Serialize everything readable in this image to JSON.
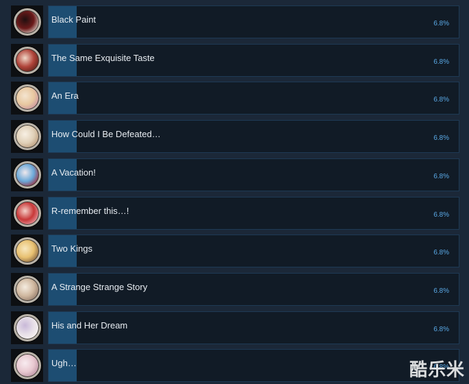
{
  "achievements": [
    {
      "name": "Black Paint",
      "percent": "6.8%",
      "fill_fraction": 0.068,
      "icon": "achievement-icon-black-paint",
      "colors": [
        "#6b1a1a",
        "#201010",
        "#d8d0c8"
      ]
    },
    {
      "name": "The Same Exquisite Taste",
      "percent": "6.8%",
      "fill_fraction": 0.068,
      "icon": "achievement-icon-exquisite-taste",
      "colors": [
        "#b0443a",
        "#f0d8c8",
        "#5a2018"
      ]
    },
    {
      "name": "An Era",
      "percent": "6.8%",
      "fill_fraction": 0.068,
      "icon": "achievement-icon-an-era",
      "colors": [
        "#e8c8a0",
        "#f4e4d0",
        "#c890a0"
      ]
    },
    {
      "name": "How Could I Be Defeated…",
      "percent": "6.8%",
      "fill_fraction": 0.068,
      "icon": "achievement-icon-defeated",
      "colors": [
        "#e0d0b8",
        "#f8f0e4",
        "#b89878"
      ]
    },
    {
      "name": "A Vacation!",
      "percent": "6.8%",
      "fill_fraction": 0.068,
      "icon": "achievement-icon-vacation",
      "colors": [
        "#6aa8d8",
        "#f0e8ec",
        "#a02838"
      ]
    },
    {
      "name": "R-remember this…!",
      "percent": "6.8%",
      "fill_fraction": 0.068,
      "icon": "achievement-icon-remember",
      "colors": [
        "#c83838",
        "#f4d0c8",
        "#e8a0a8"
      ]
    },
    {
      "name": "Two Kings",
      "percent": "6.8%",
      "fill_fraction": 0.068,
      "icon": "achievement-icon-two-kings",
      "colors": [
        "#e8c070",
        "#f8e8c0",
        "#806040"
      ]
    },
    {
      "name": "A Strange Strange Story",
      "percent": "6.8%",
      "fill_fraction": 0.068,
      "icon": "achievement-icon-strange-story",
      "colors": [
        "#d0b8a0",
        "#f4ece0",
        "#907868"
      ]
    },
    {
      "name": "His and Her Dream",
      "percent": "6.8%",
      "fill_fraction": 0.068,
      "icon": "achievement-icon-dream",
      "colors": [
        "#e8e0e8",
        "#c8b8d8",
        "#f8f4f0"
      ]
    },
    {
      "name": "Ugh…",
      "percent": "6.8%",
      "fill_fraction": 0.068,
      "icon": "achievement-icon-ugh",
      "colors": [
        "#e8c8d0",
        "#f8ecf0",
        "#b890a0"
      ]
    }
  ],
  "watermark": "酷乐米",
  "colors": {
    "background": "#1b2838",
    "bar_background": "#111b26",
    "bar_fill": "#1d4d72",
    "percent_text": "#5aa9e6"
  }
}
